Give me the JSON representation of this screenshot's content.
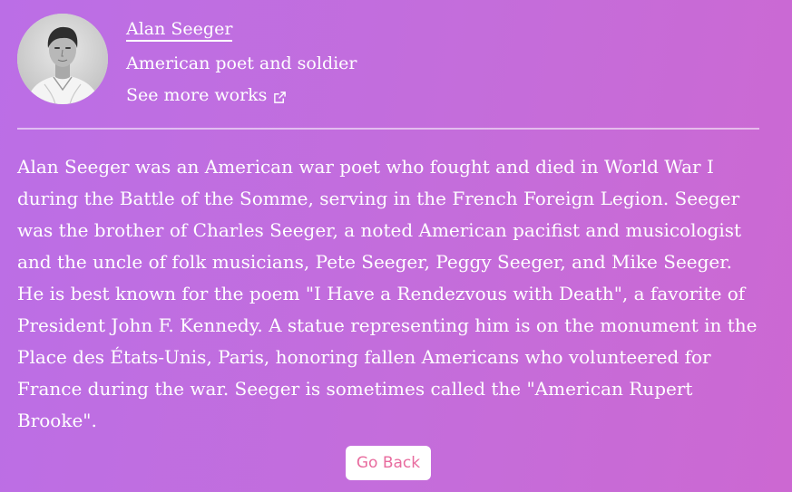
{
  "author": {
    "name": "Alan Seeger",
    "description": "American poet and soldier",
    "see_more_label": "See more works"
  },
  "bio": {
    "text": "Alan Seeger was an American war poet who fought and died in World War I during the Battle of the Somme, serving in the French Foreign Legion. Seeger was the brother of Charles Seeger, a noted American pacifist and musicologist and the uncle of folk musicians, Pete Seeger, Peggy Seeger, and Mike Seeger. He is best known for the poem \"I Have a Rendezvous with Death\", a favorite of President John F. Kennedy. A statue representing him is on the monument in the Place des États-Unis, Paris, honoring fallen Americans who volunteered for France during the war. Seeger is sometimes called the \"American Rupert Brooke\"."
  },
  "actions": {
    "go_back_label": "Go Back"
  },
  "icons": {
    "see_more": "external-link-icon"
  },
  "colors": {
    "background_start": "#bb6ee6",
    "background_end": "#cc68d2",
    "button_text": "#e86b9e",
    "button_bg": "#ffffff"
  }
}
